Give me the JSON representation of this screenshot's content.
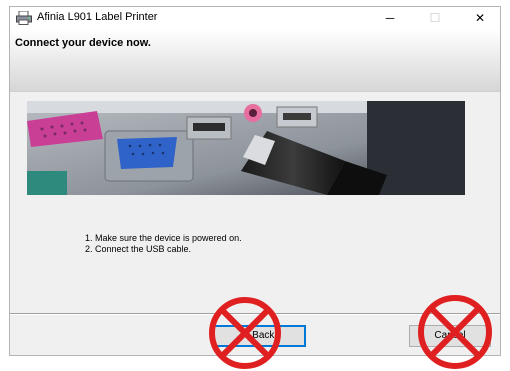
{
  "window": {
    "title": "Afinia L901 Label Printer",
    "minimize_glyph": "─",
    "maximize_glyph": "☐",
    "close_glyph": "✕"
  },
  "header": {
    "title": "Connect your device now."
  },
  "instructions": [
    "1. Make sure the device is powered on.",
    "2. Connect the USB cable."
  ],
  "buttons": {
    "back_label": "< Back",
    "cancel_label": "Cancel"
  },
  "colors": {
    "focus_accent": "#0078d7",
    "prohibition_red": "#e02020"
  },
  "icons": [
    "printer-icon",
    "prohibited-icon"
  ]
}
